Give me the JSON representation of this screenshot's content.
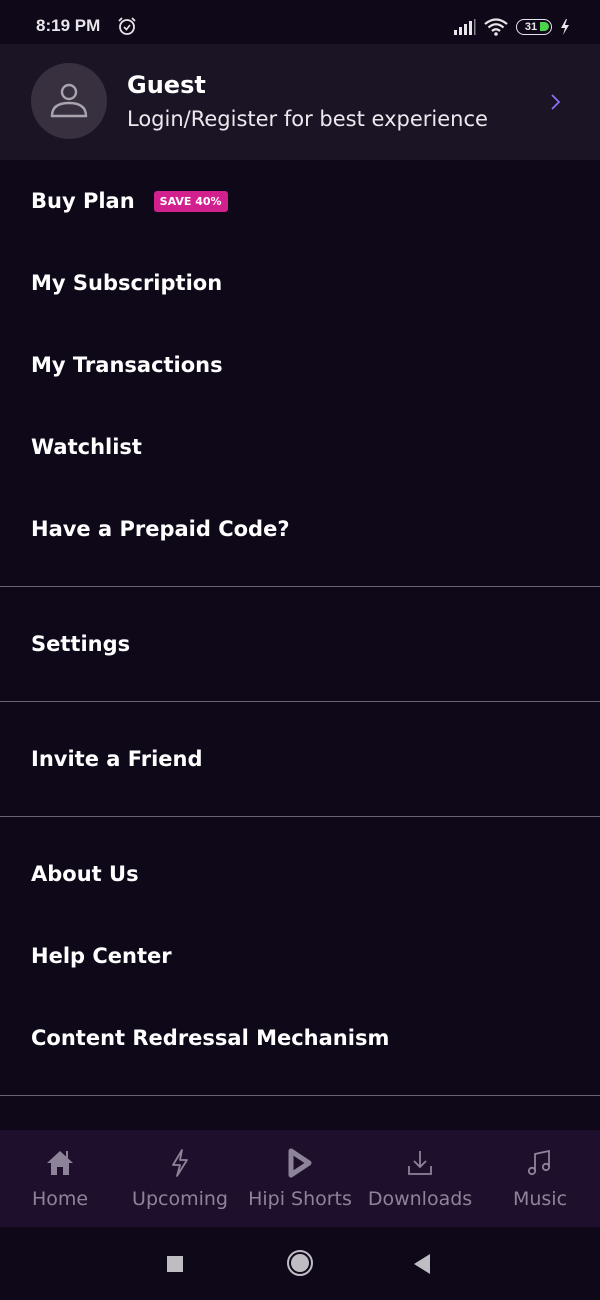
{
  "status_bar": {
    "time": "8:19 PM",
    "battery": "31",
    "icons": [
      "alarm-icon",
      "signal-icon",
      "wifi-icon",
      "battery-icon",
      "charging-icon"
    ]
  },
  "profile": {
    "name": "Guest",
    "subtitle": "Login/Register for best experience"
  },
  "menu": {
    "group1": [
      {
        "label": "Buy Plan",
        "badge": "SAVE 40%"
      },
      {
        "label": "My Subscription"
      },
      {
        "label": "My Transactions"
      },
      {
        "label": "Watchlist"
      },
      {
        "label": "Have a Prepaid Code?"
      }
    ],
    "settings": "Settings",
    "invite": "Invite a Friend",
    "group3": [
      {
        "label": "About Us"
      },
      {
        "label": "Help Center"
      },
      {
        "label": "Content Redressal Mechanism"
      }
    ]
  },
  "bottom_nav": [
    {
      "label": "Home",
      "icon": "home-icon"
    },
    {
      "label": "Upcoming",
      "icon": "lightning-icon"
    },
    {
      "label": "Hipi Shorts",
      "icon": "play-icon"
    },
    {
      "label": "Downloads",
      "icon": "download-icon"
    },
    {
      "label": "Music",
      "icon": "music-icon"
    }
  ],
  "colors": {
    "background": "#0e0818",
    "profile_bg": "#1b1424",
    "badge": "#d2208e",
    "accent_chevron": "#8b6ef5",
    "nav_bg": "#1e0f2c"
  }
}
